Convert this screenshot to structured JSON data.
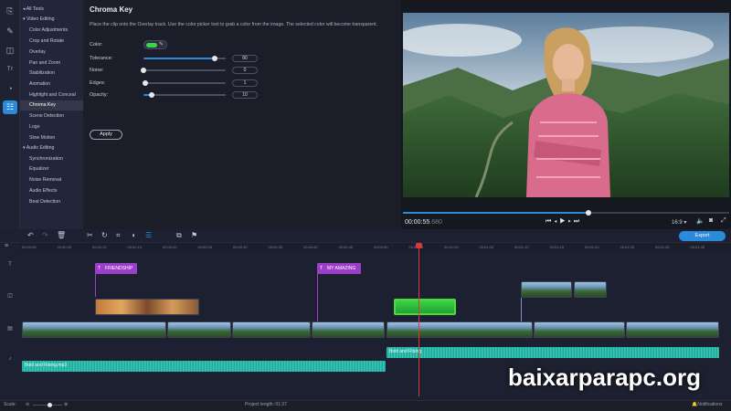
{
  "toolstrip": {
    "tools": [
      {
        "name": "import-icon",
        "glyph": "⎘"
      },
      {
        "name": "wand-icon",
        "glyph": "✎"
      },
      {
        "name": "transitions-icon",
        "glyph": "◫"
      },
      {
        "name": "titles-icon",
        "glyph": "Tт"
      },
      {
        "name": "stickers-icon",
        "glyph": "◔"
      },
      {
        "name": "more-tools-icon",
        "glyph": "☷"
      }
    ]
  },
  "sidebar": {
    "items": [
      {
        "label": "All Tools",
        "type": "group",
        "arrow": "◂"
      },
      {
        "label": "Video Editing",
        "type": "group",
        "arrow": "▾"
      },
      {
        "label": "Color Adjustments",
        "type": "item"
      },
      {
        "label": "Crop and Rotate",
        "type": "item"
      },
      {
        "label": "Overlay",
        "type": "item"
      },
      {
        "label": "Pan and Zoom",
        "type": "item"
      },
      {
        "label": "Stabilization",
        "type": "item"
      },
      {
        "label": "Animation",
        "type": "item"
      },
      {
        "label": "Highlight and Conceal",
        "type": "item"
      },
      {
        "label": "Chroma Key",
        "type": "item",
        "selected": true
      },
      {
        "label": "Scene Detection",
        "type": "item"
      },
      {
        "label": "Logo",
        "type": "item"
      },
      {
        "label": "Slow Motion",
        "type": "item"
      },
      {
        "label": "Audio Editing",
        "type": "group",
        "arrow": "▾"
      },
      {
        "label": "Synchronization",
        "type": "item"
      },
      {
        "label": "Equalizer",
        "type": "item"
      },
      {
        "label": "Noise Removal",
        "type": "item"
      },
      {
        "label": "Audio Effects",
        "type": "item"
      },
      {
        "label": "Beat Detection",
        "type": "item"
      }
    ]
  },
  "panel": {
    "title": "Chroma Key",
    "description": "Place the clip onto the Overlay track. Use the color picker tool to grab a color from the image. The selected color will become transparent.",
    "color_label": "Color:",
    "color_value": "#3bd44a",
    "params": [
      {
        "label": "Tolerance:",
        "value": "80",
        "level": 0.87
      },
      {
        "label": "Noise:",
        "value": "0",
        "level": 0.0
      },
      {
        "label": "Edges:",
        "value": "1",
        "level": 0.02
      },
      {
        "label": "Opacity:",
        "value": "10",
        "level": 0.1
      }
    ],
    "apply_label": "Apply"
  },
  "player": {
    "time_current": "00:00:55",
    "time_frac": ".680",
    "progress": 0.57,
    "aspect": "16:9 ▾"
  },
  "timeline": {
    "export_label": "Export",
    "ticks": [
      "00:00:00",
      "00:00:05",
      "00:00:10",
      "00:00:15",
      "00:00:20",
      "00:00:25",
      "00:00:30",
      "00:00:35",
      "00:00:40",
      "00:00:45",
      "00:00:50",
      "00:00:55",
      "00:01:00",
      "00:01:05",
      "00:01:10",
      "00:01:15",
      "00:01:20",
      "00:01:25",
      "00:01:30",
      "00:01:35"
    ],
    "titles": [
      {
        "label": "FRIENDSHIP"
      },
      {
        "label": "MY AMAZING"
      }
    ],
    "audio_labels": [
      "Bold and Rising.mp3",
      "Bold and Rising"
    ]
  },
  "status": {
    "scale_label": "Scale:",
    "project_length": "Project length:  01:37",
    "notifications": "Notifications"
  },
  "watermark": "baixarparapc.org",
  "colors": {
    "accent": "#2a8bdc",
    "title_clip": "#9b3fc8",
    "audio": "#2db7a9",
    "playhead": "#e0363c"
  }
}
